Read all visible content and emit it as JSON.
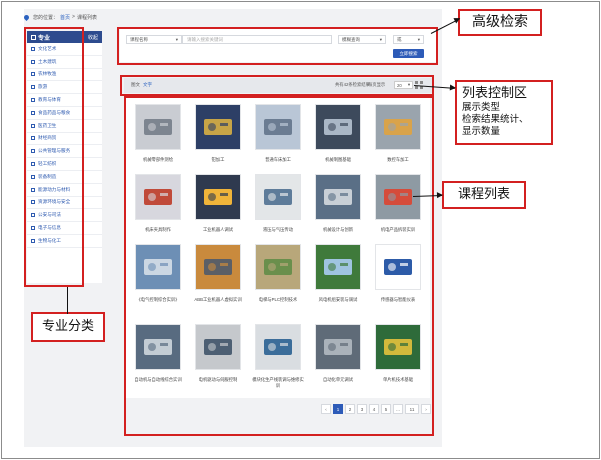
{
  "breadcrumb": {
    "home": "您的位置：",
    "first": "首页",
    "separator": ">",
    "current": "课程列表"
  },
  "sidebar": {
    "title": "专业",
    "all": "收起",
    "items": [
      "文化艺术",
      "土木建筑",
      "农林牧渔",
      "旅游",
      "教育与体育",
      "食品药品与粮食",
      "医药卫生",
      "财经商贸",
      "公共管理与服务",
      "轻工纺织",
      "装备制造",
      "能源动力与材料",
      "资源环境与安全",
      "公安与司法",
      "电子与信息",
      "生物与化工"
    ]
  },
  "search": {
    "course_select": "课程名称",
    "keyword_placeholder": "请输入搜索关键词",
    "mode_select": "模糊查询",
    "logic_select": "或",
    "button": "立即搜索"
  },
  "list_controls": {
    "view_picture": "图文",
    "view_text": "文字",
    "stats": "共有42条检索结果",
    "result_count": "42",
    "page_info": "每页显示",
    "page_size": "20",
    "grid_icon": "grid-view-icon"
  },
  "courses": [
    "机械零部件测绘",
    "钳加工",
    "普通车床加工",
    "机械制图基础",
    "数控车加工",
    "机床夹具制作",
    "工业机器人调试",
    "液压与气压传动",
    "机械设计与创新",
    "机电产品拆装实训",
    "《电气控制综合实训》",
    "ABB工业机器人虚拟实训",
    "电梯与PLC控制技术",
    "风电机组安装与调试",
    "传感器与智能仪表",
    "自动机与自动线综合实训",
    "电机驱动与伺服控制",
    "模块化生产线装调与维修实训",
    "自动化单元调试",
    "单片机技术基础"
  ],
  "pagination": {
    "prev": "‹",
    "pages": [
      "1",
      "2",
      "3",
      "4",
      "5"
    ],
    "ellipsis": "…",
    "last": "11",
    "next": "›"
  },
  "annotations": {
    "advanced_search": "高级检索",
    "list_control": "列表控制区",
    "list_control_detail_1": "展示类型",
    "list_control_detail_2": "检索结果统计、",
    "list_control_detail_3": "显示数量",
    "course_list": "课程列表",
    "major_category": "专业分类"
  },
  "colors": {
    "annotation_red": "#d32020",
    "brand_blue": "#2d4b8e",
    "button_blue": "#2d5bb8"
  }
}
